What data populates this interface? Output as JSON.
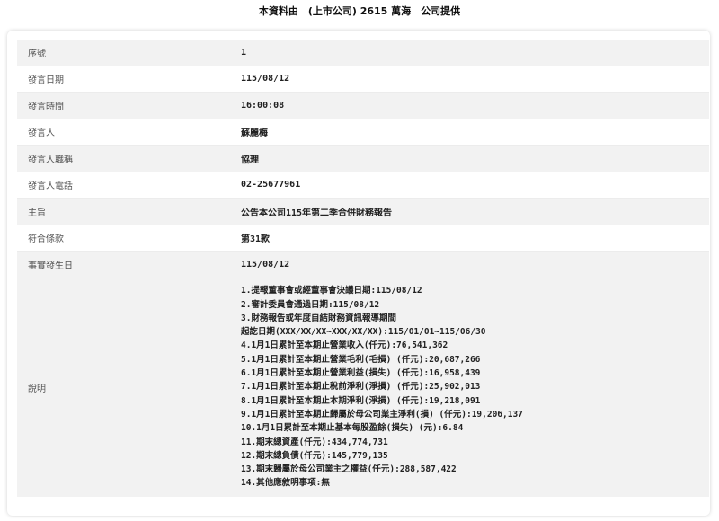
{
  "header": {
    "text": "本資料由　(上市公司) 2615 萬海　公司提供"
  },
  "rows": [
    {
      "label": "序號",
      "value": "1"
    },
    {
      "label": "發言日期",
      "value": "115/08/12"
    },
    {
      "label": "發言時間",
      "value": "16:00:08"
    },
    {
      "label": "發言人",
      "value": "蘇麗梅"
    },
    {
      "label": "發言人職稱",
      "value": "協理"
    },
    {
      "label": "發言人電話",
      "value": "02-25677961"
    },
    {
      "label": "主旨",
      "value": "公告本公司115年第二季合併財務報告"
    },
    {
      "label": "符合條款",
      "value": "第31款"
    },
    {
      "label": "事實發生日",
      "value": "115/08/12"
    }
  ],
  "description": {
    "label": "說明",
    "lines": [
      "1.提報董事會或經董事會決議日期:115/08/12",
      "2.審計委員會通過日期:115/08/12",
      "3.財務報告或年度自結財務資訊報導期間",
      "起訖日期(XXX/XX/XX~XXX/XX/XX):115/01/01~115/06/30",
      "4.1月1日累計至本期止營業收入(仟元):76,541,362",
      "5.1月1日累計至本期止營業毛利(毛損) (仟元):20,687,266",
      "6.1月1日累計至本期止營業利益(損失) (仟元):16,958,439",
      "7.1月1日累計至本期止稅前淨利(淨損) (仟元):25,902,013",
      "8.1月1日累計至本期止本期淨利(淨損) (仟元):19,218,091",
      "9.1月1日累計至本期止歸屬於母公司業主淨利(損) (仟元):19,206,137",
      "10.1月1日累計至本期止基本每股盈餘(損失) (元):6.84",
      "11.期末總資產(仟元):434,774,731",
      "12.期末總負債(仟元):145,779,135",
      "13.期末歸屬於母公司業主之權益(仟元):288,587,422",
      "14.其他應敘明事項:無"
    ]
  }
}
